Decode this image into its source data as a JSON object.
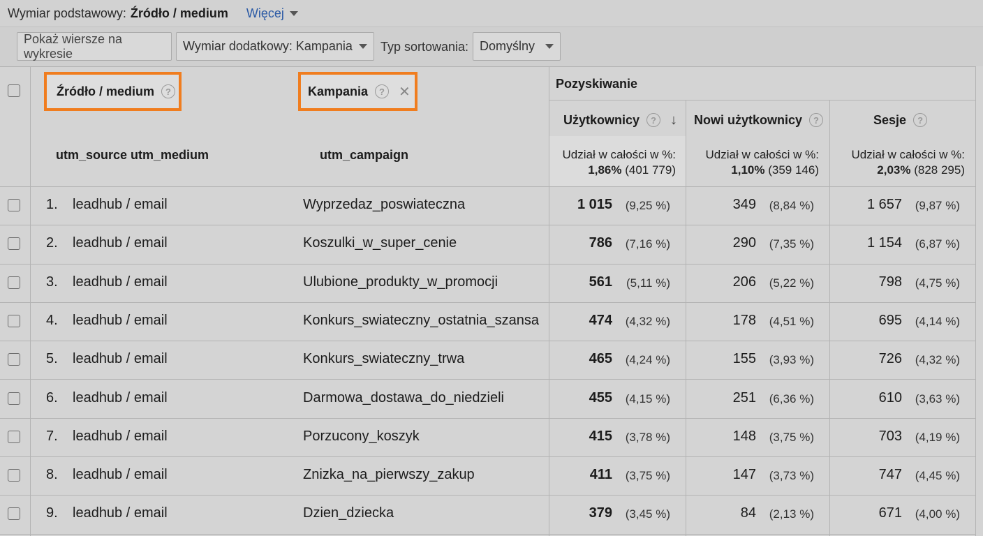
{
  "dimension_bar": {
    "label": "Wymiar podstawowy:",
    "value": "Źródło / medium",
    "more": "Więcej"
  },
  "toolbar": {
    "plot_rows": "Pokaż wiersze na wykresie",
    "secondary_dimension": "Wymiar dodatkowy: Kampania",
    "sort_label": "Typ sortowania:",
    "sort_value": "Domyślny"
  },
  "columns": {
    "source_medium": "Źródło / medium",
    "campaign": "Kampania",
    "group": "Pozyskiwanie",
    "users": "Użytkownicy",
    "new_users": "Nowi użytkownicy",
    "sessions": "Sesje",
    "source_medium_sub": "utm_source utm_medium",
    "campaign_sub": "utm_campaign"
  },
  "totals": {
    "users": {
      "label": "Udział w całości w %:",
      "pct": "1,86%",
      "total": "(401 779)"
    },
    "new_users": {
      "label": "Udział w całości w %:",
      "pct": "1,10%",
      "total": "(359 146)"
    },
    "sessions": {
      "label": "Udział w całości w %:",
      "pct": "2,03%",
      "total": "(828 295)"
    }
  },
  "rows": [
    {
      "idx": "1.",
      "source": "leadhub / email",
      "campaign": "Wyprzedaz_poswiateczna",
      "users": "1 015",
      "users_pct": "(9,25 %)",
      "new_users": "349",
      "new_users_pct": "(8,84 %)",
      "sessions": "1 657",
      "sessions_pct": "(9,87 %)"
    },
    {
      "idx": "2.",
      "source": "leadhub / email",
      "campaign": "Koszulki_w_super_cenie",
      "users": "786",
      "users_pct": "(7,16 %)",
      "new_users": "290",
      "new_users_pct": "(7,35 %)",
      "sessions": "1 154",
      "sessions_pct": "(6,87 %)"
    },
    {
      "idx": "3.",
      "source": "leadhub / email",
      "campaign": "Ulubione_produkty_w_promocji",
      "users": "561",
      "users_pct": "(5,11 %)",
      "new_users": "206",
      "new_users_pct": "(5,22 %)",
      "sessions": "798",
      "sessions_pct": "(4,75 %)"
    },
    {
      "idx": "4.",
      "source": "leadhub / email",
      "campaign": "Konkurs_swiateczny_ostatnia_szansa",
      "users": "474",
      "users_pct": "(4,32 %)",
      "new_users": "178",
      "new_users_pct": "(4,51 %)",
      "sessions": "695",
      "sessions_pct": "(4,14 %)"
    },
    {
      "idx": "5.",
      "source": "leadhub / email",
      "campaign": "Konkurs_swiateczny_trwa",
      "users": "465",
      "users_pct": "(4,24 %)",
      "new_users": "155",
      "new_users_pct": "(3,93 %)",
      "sessions": "726",
      "sessions_pct": "(4,32 %)"
    },
    {
      "idx": "6.",
      "source": "leadhub / email",
      "campaign": "Darmowa_dostawa_do_niedzieli",
      "users": "455",
      "users_pct": "(4,15 %)",
      "new_users": "251",
      "new_users_pct": "(6,36 %)",
      "sessions": "610",
      "sessions_pct": "(3,63 %)"
    },
    {
      "idx": "7.",
      "source": "leadhub / email",
      "campaign": "Porzucony_koszyk",
      "users": "415",
      "users_pct": "(3,78 %)",
      "new_users": "148",
      "new_users_pct": "(3,75 %)",
      "sessions": "703",
      "sessions_pct": "(4,19 %)"
    },
    {
      "idx": "8.",
      "source": "leadhub / email",
      "campaign": "Znizka_na_pierwszy_zakup",
      "users": "411",
      "users_pct": "(3,75 %)",
      "new_users": "147",
      "new_users_pct": "(3,73 %)",
      "sessions": "747",
      "sessions_pct": "(4,45 %)"
    },
    {
      "idx": "9.",
      "source": "leadhub / email",
      "campaign": "Dzien_dziecka",
      "users": "379",
      "users_pct": "(3,45 %)",
      "new_users": "84",
      "new_users_pct": "(2,13 %)",
      "sessions": "671",
      "sessions_pct": "(4,00 %)"
    }
  ],
  "colors": {
    "highlight": "#f07d1f",
    "link": "#2b5aa5"
  }
}
